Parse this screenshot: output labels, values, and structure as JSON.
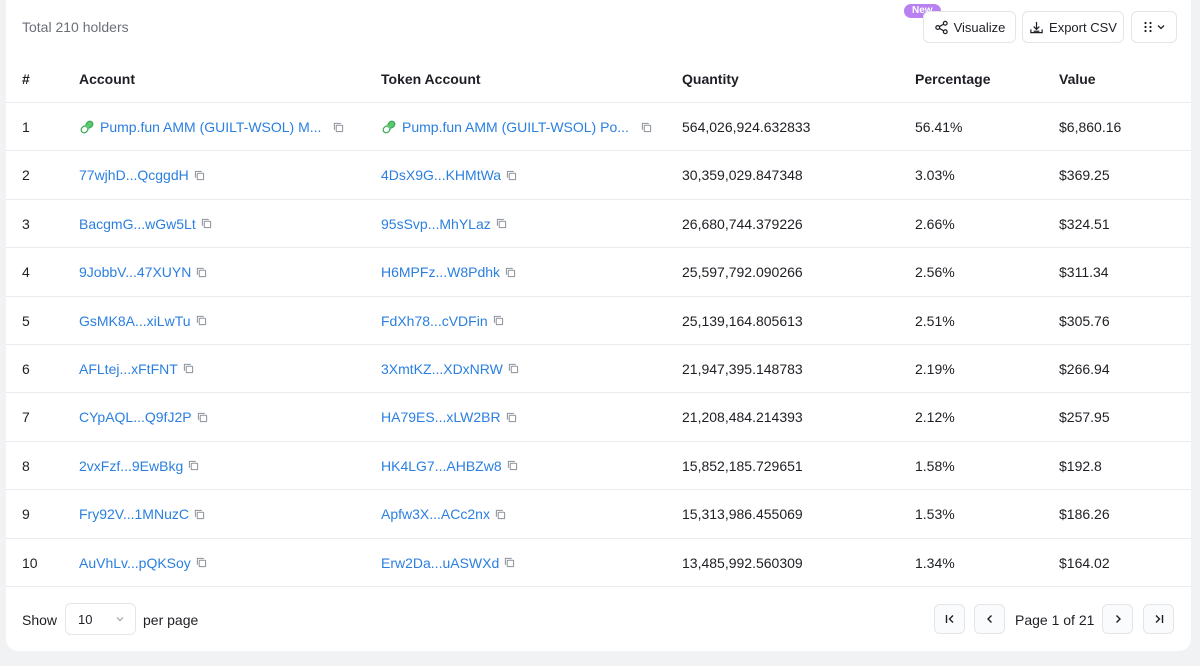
{
  "header": {
    "total": "Total 210 holders",
    "new_badge": "New",
    "visualize_label": "Visualize",
    "export_label": "Export CSV"
  },
  "columns": {
    "idx": "#",
    "account": "Account",
    "token_account": "Token Account",
    "quantity": "Quantity",
    "percentage": "Percentage",
    "value": "Value"
  },
  "rows": [
    {
      "idx": "1",
      "account": "Pump.fun AMM (GUILT-WSOL) M...",
      "token_account": "Pump.fun AMM (GUILT-WSOL) Po...",
      "quantity": "564,026,924.632833",
      "percentage": "56.41%",
      "value": "$6,860.16",
      "account_icon": "pill-icon",
      "token_icon": "pill-icon"
    },
    {
      "idx": "2",
      "account": "77wjhD...QcggdH",
      "token_account": "4DsX9G...KHMtWa",
      "quantity": "30,359,029.847348",
      "percentage": "3.03%",
      "value": "$369.25"
    },
    {
      "idx": "3",
      "account": "BacgmG...wGw5Lt",
      "token_account": "95sSvp...MhYLaz",
      "quantity": "26,680,744.379226",
      "percentage": "2.66%",
      "value": "$324.51"
    },
    {
      "idx": "4",
      "account": "9JobbV...47XUYN",
      "token_account": "H6MPFz...W8Pdhk",
      "quantity": "25,597,792.090266",
      "percentage": "2.56%",
      "value": "$311.34"
    },
    {
      "idx": "5",
      "account": "GsMK8A...xiLwTu",
      "token_account": "FdXh78...cVDFin",
      "quantity": "25,139,164.805613",
      "percentage": "2.51%",
      "value": "$305.76"
    },
    {
      "idx": "6",
      "account": "AFLtej...xFtFNT",
      "token_account": "3XmtKZ...XDxNRW",
      "quantity": "21,947,395.148783",
      "percentage": "2.19%",
      "value": "$266.94"
    },
    {
      "idx": "7",
      "account": "CYpAQL...Q9fJ2P",
      "token_account": "HA79ES...xLW2BR",
      "quantity": "21,208,484.214393",
      "percentage": "2.12%",
      "value": "$257.95"
    },
    {
      "idx": "8",
      "account": "2vxFzf...9EwBkg",
      "token_account": "HK4LG7...AHBZw8",
      "quantity": "15,852,185.729651",
      "percentage": "1.58%",
      "value": "$192.8"
    },
    {
      "idx": "9",
      "account": "Fry92V...1MNuzC",
      "token_account": "Apfw3X...ACc2nx",
      "quantity": "15,313,986.455069",
      "percentage": "1.53%",
      "value": "$186.26"
    },
    {
      "idx": "10",
      "account": "AuVhLv...pQKSoy",
      "token_account": "Erw2Da...uASWXd",
      "quantity": "13,485,992.560309",
      "percentage": "1.34%",
      "value": "$164.02"
    }
  ],
  "footer": {
    "show_label": "Show",
    "page_size": "10",
    "per_page_label": "per page",
    "page_text": "Page 1 of 21"
  },
  "colors": {
    "link": "#2b7fe0",
    "badge": "#b880f0"
  }
}
